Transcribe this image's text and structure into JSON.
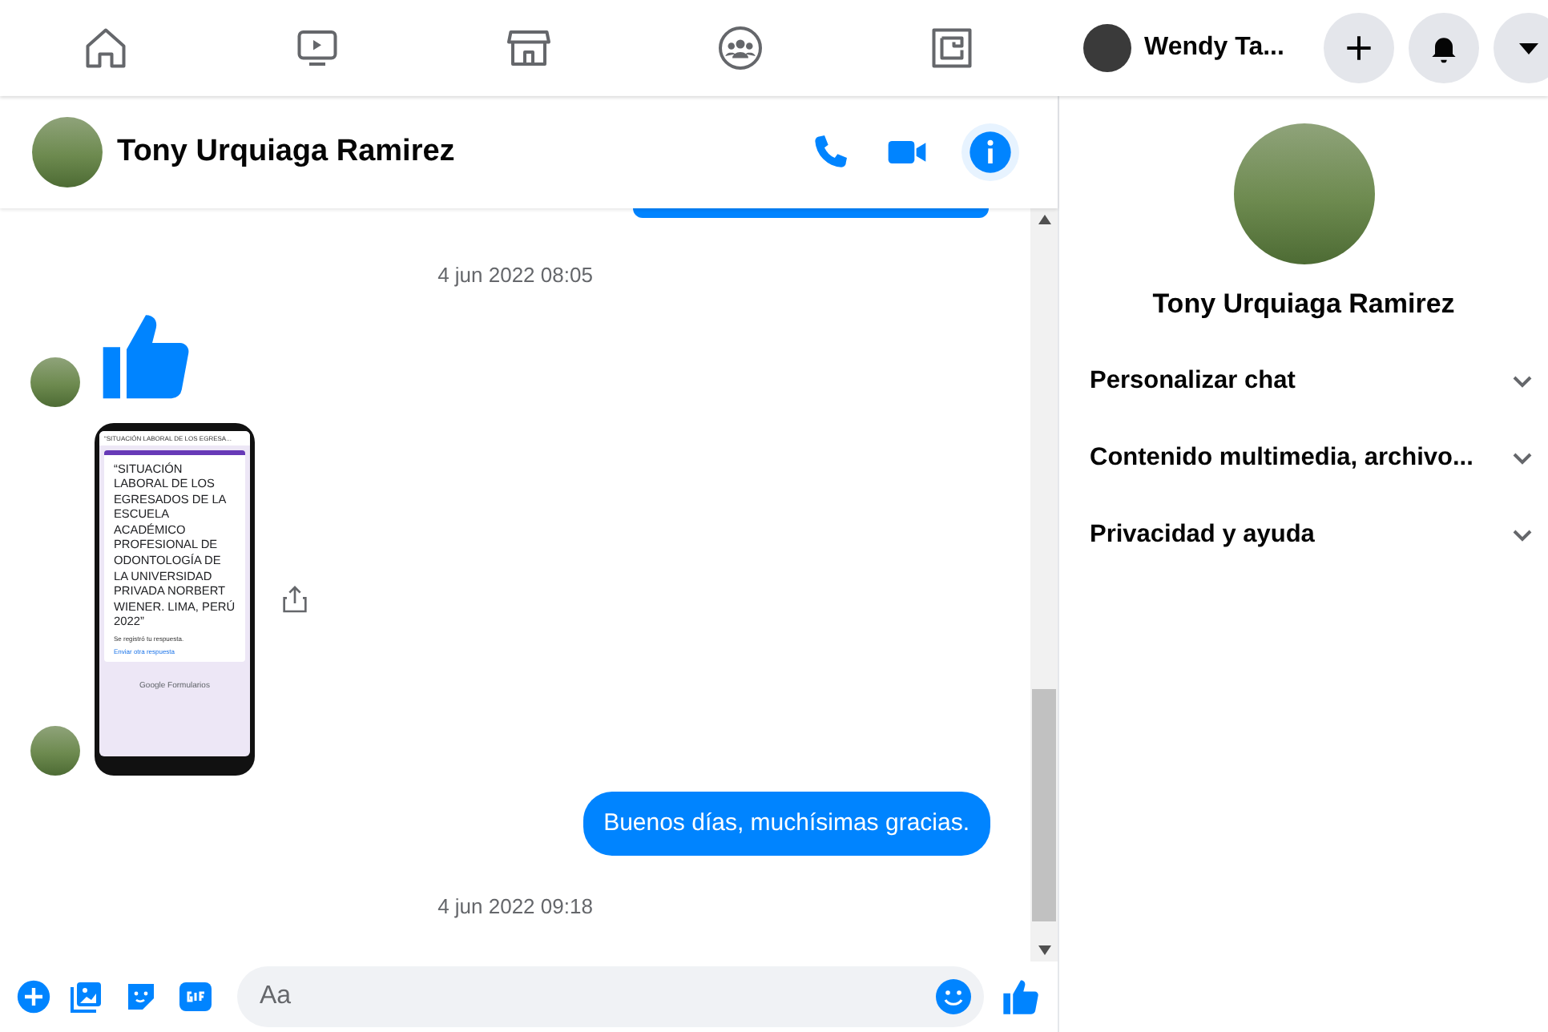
{
  "nav": {
    "tabs": [
      {
        "kind": "home",
        "selected": false
      },
      {
        "kind": "watch",
        "selected": false
      },
      {
        "kind": "marketplace",
        "selected": false
      },
      {
        "kind": "groups",
        "selected": false
      },
      {
        "kind": "gaming",
        "selected": false
      }
    ],
    "profile_name": "Wendy Ta..."
  },
  "chat": {
    "contact": "Tony Urquiaga Ramirez",
    "messages": [
      {
        "kind": "timestamp",
        "text": "4 jun 2022 08:05"
      },
      {
        "kind": "like"
      },
      {
        "kind": "screenshot",
        "header": "“SITUACIÓN LABORAL DE LOS EGRESA...",
        "title": "“SITUACIÓN LABORAL DE LOS EGRESADOS DE LA ESCUELA ACADÉMICO PROFESIONAL DE ODONTOLOGÍA DE LA UNIVERSIDAD PRIVADA NORBERT WIENER. LIMA, PERÚ 2022”",
        "note": "Se registró tu respuesta.",
        "link": "Enviar otra respuesta",
        "footer": "Google Formularios"
      },
      {
        "kind": "outgoing",
        "text": "Buenos días, muchísimas gracias."
      },
      {
        "kind": "timestamp",
        "text": "4 jun 2022 09:18"
      }
    ],
    "composer": {
      "placeholder": "Aa"
    }
  },
  "info_panel": {
    "name": "Tony Urquiaga Ramirez",
    "sections": [
      {
        "label": "Personalizar chat",
        "expanded": false
      },
      {
        "label": "Contenido multimedia, archivo...",
        "expanded": false
      },
      {
        "label": "Privacidad y ayuda",
        "expanded": false
      }
    ]
  }
}
